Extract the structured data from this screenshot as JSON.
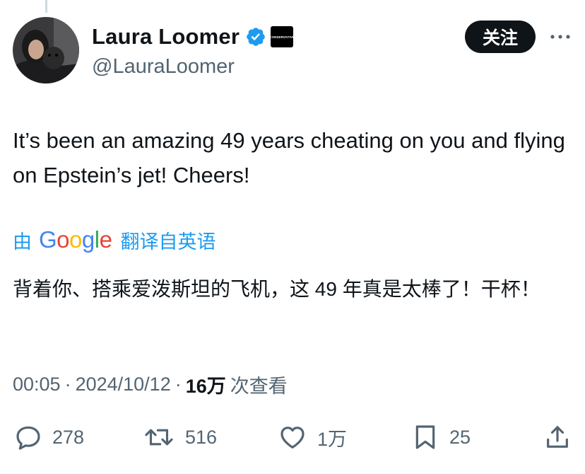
{
  "author": {
    "display_name": "Laura Loomer",
    "handle": "@LauraLoomer",
    "affiliate_badge": "CONSERVATIVE"
  },
  "follow_label": "关注",
  "tweet": {
    "text": "It’s been an amazing 49 years cheating on you and flying on Epstein’s jet! Cheers!"
  },
  "translation": {
    "by_prefix": "由",
    "provider": "Google",
    "from_label": "翻译自英语",
    "text": "背着你、搭乘爱泼斯坦的飞机，这 49 年真是太棒了！干杯！"
  },
  "meta": {
    "time": "00:05",
    "separator": "·",
    "date": "2024/10/12",
    "views_count": "16万",
    "views_label": "次查看"
  },
  "actions": {
    "replies": "278",
    "reposts": "516",
    "likes": "1万",
    "bookmarks": "25"
  },
  "colors": {
    "accent": "#1d9bf0",
    "text_primary": "#0f1419",
    "text_secondary": "#536471"
  },
  "icons": {
    "verified": "verified-badge-icon",
    "more": "more-icon",
    "reply": "reply-icon",
    "repost": "repost-icon",
    "like": "heart-icon",
    "bookmark": "bookmark-icon",
    "share": "share-icon"
  }
}
